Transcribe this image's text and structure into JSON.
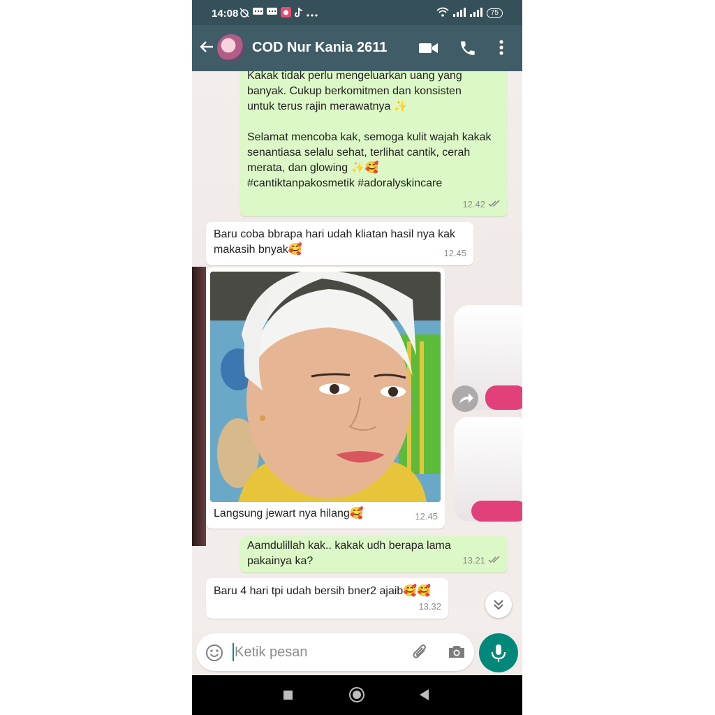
{
  "status": {
    "time": "14:08",
    "battery": "75"
  },
  "header": {
    "contact_name": "COD Nur Kania 2611"
  },
  "messages": [
    {
      "lines": [
        "Kakak tidak perlu mengeluarkan uang yang",
        "banyak. Cukup berkomitmen dan konsisten",
        "untuk terus rajin merawatnya ✨"
      ],
      "lines2": [
        "Selamat mencoba kak, semoga kulit wajah kakak",
        "senantiasa selalu sehat, terlihat cantik, cerah",
        "merata, dan glowing ✨🥰",
        "#cantiktanpakosmetik #adoralyskincare"
      ],
      "time": "12.42"
    },
    {
      "lines": [
        "Baru coba bbrapa hari udah kliatan hasil nya kak",
        "makasih bnyak🥰"
      ],
      "time": "12.45"
    },
    {
      "caption": "Langsung jewart nya hilang🥰",
      "time": "12.45"
    },
    {
      "lines": [
        "Aamdulillah kak.. kakak udh berapa lama",
        "pakainya ka?"
      ],
      "time": "13.21"
    },
    {
      "lines": [
        "Baru 4 hari tpi udah bersih bner2 ajaib🥰🥰"
      ],
      "time": "13.32"
    }
  ],
  "input": {
    "placeholder": "Ketik pesan"
  },
  "icons": {
    "back": "arrow-left-icon",
    "video": "video-call-icon",
    "call": "phone-icon",
    "more": "more-vert-icon",
    "emoji": "emoji-icon",
    "attach": "paperclip-icon",
    "camera": "camera-icon",
    "mic": "mic-icon",
    "forward": "forward-icon",
    "scroll": "double-chevron-down-icon"
  },
  "colors": {
    "header": "#405c66",
    "statusbar": "#36505a",
    "outgoing_bubble": "#dcf8c6",
    "incoming_bubble": "#ffffff",
    "accent": "#00897b",
    "read_ticks": "#8a9089"
  }
}
